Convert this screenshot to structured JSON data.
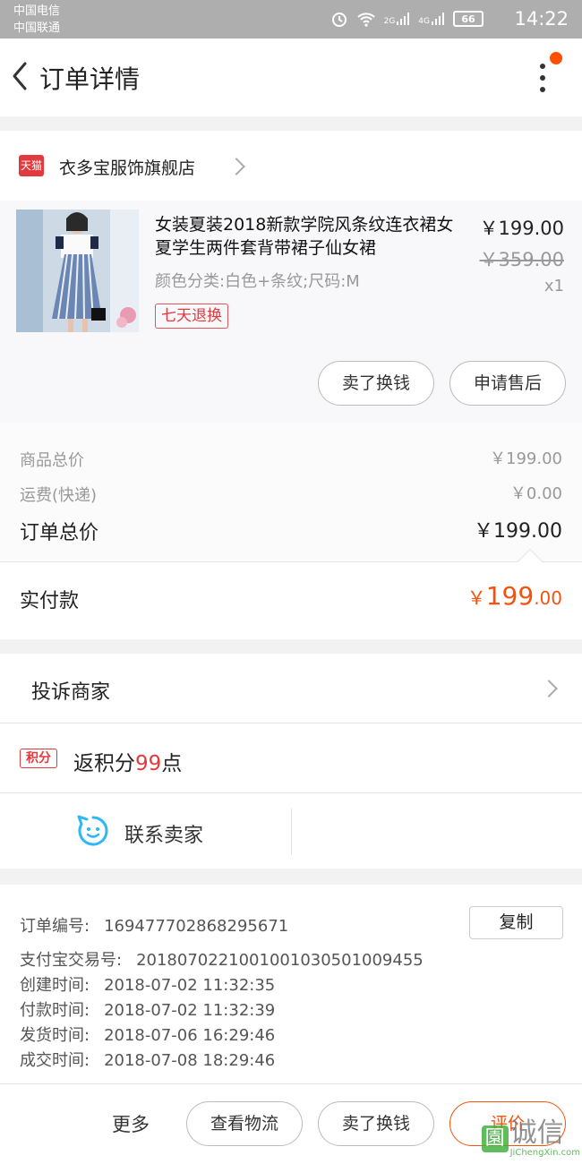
{
  "status_bar": {
    "carrier1": "中国电信",
    "carrier2": "中国联通",
    "net1": "2G",
    "net2": "4G",
    "battery": "66",
    "time": "14:22"
  },
  "header": {
    "title": "订单详情"
  },
  "store": {
    "badge": "天猫",
    "name": "衣多宝服饰旗舰店"
  },
  "product": {
    "title": "女装夏装2018新款学院风条纹连衣裙女夏学生两件套背带裙子仙女裙",
    "attributes": "颜色分类:白色+条纹;尺码:M",
    "tag": "七天退换",
    "price": "￥199.00",
    "original_price": "￥359.00",
    "quantity": "x1"
  },
  "item_actions": {
    "sell_label": "卖了换钱",
    "after_sale_label": "申请售后"
  },
  "summary": {
    "goods_label": "商品总价",
    "goods_value": "￥199.00",
    "shipping_label": "运费(快递)",
    "shipping_value": "￥0.00",
    "order_total_label": "订单总价",
    "order_total_value": "￥199.00",
    "paid_label": "实付款",
    "paid_symbol": "￥",
    "paid_int": "199",
    "paid_dec": ".00"
  },
  "complaint": {
    "label": "投诉商家"
  },
  "points": {
    "badge": "积分",
    "prefix": "返积分",
    "value": "99",
    "suffix": "点"
  },
  "contact": {
    "label": "联系卖家"
  },
  "order_info": {
    "order_no_label": "订单编号:",
    "order_no": "169477702868295671",
    "copy_label": "复制",
    "alipay_label": "支付宝交易号:",
    "alipay_no": "2018070221001001030501009455",
    "created_label": "创建时间:",
    "created": "2018-07-02 11:32:35",
    "paid_label": "付款时间:",
    "paid": "2018-07-02 11:32:39",
    "shipped_label": "发货时间:",
    "shipped": "2018-07-06 16:29:46",
    "completed_label": "成交时间:",
    "completed": "2018-07-08 18:29:46"
  },
  "bottom_bar": {
    "more": "更多",
    "logistics": "查看物流",
    "sell": "卖了换钱",
    "review": "评价"
  },
  "watermark": {
    "logo_char": "園",
    "text": "诚信",
    "url": "JiChengXin.com"
  },
  "colors": {
    "accent": "#f4530f",
    "tmall_red": "#e4393c",
    "contact_blue": "#2db7f5"
  }
}
